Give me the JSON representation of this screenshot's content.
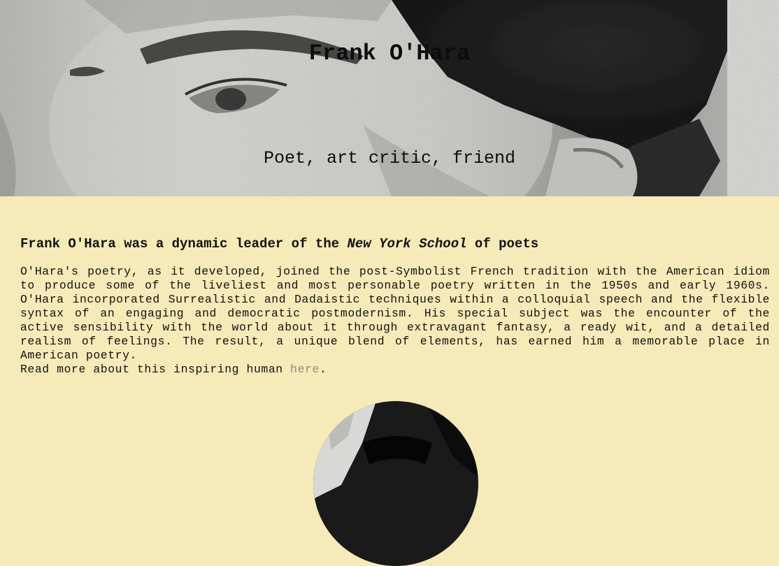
{
  "hero": {
    "title": "Frank O'Hara",
    "subtitle": "Poet, art critic, friend",
    "image_icon": "portrait-photo"
  },
  "article": {
    "lead_before": "Frank O'Hara was a dynamic leader of the ",
    "lead_em": "New York School",
    "lead_after": " of poets",
    "body": "O'Hara's poetry, as it developed, joined the post-Symbolist French tradition with the American idiom to produce some of the liveliest and most personable poetry written in the 1950s and early 1960s. O'Hara incorporated Surrealistic and Dadaistic techniques within a colloquial speech and the flexible syntax of an engaging and democratic postmodernism. His special subject was the encounter of the active sensibility with the world about it through extravagant fantasy, a ready wit, and a detailed realism of feelings. The result, a unique blend of elements, has earned him a memorable place in American poetry.",
    "more_before": "Read more about this inspiring human ",
    "more_link": "here",
    "more_after": "."
  },
  "colors": {
    "page_background": "#f6eab8",
    "link": "#8a8a86",
    "text": "#111111"
  }
}
